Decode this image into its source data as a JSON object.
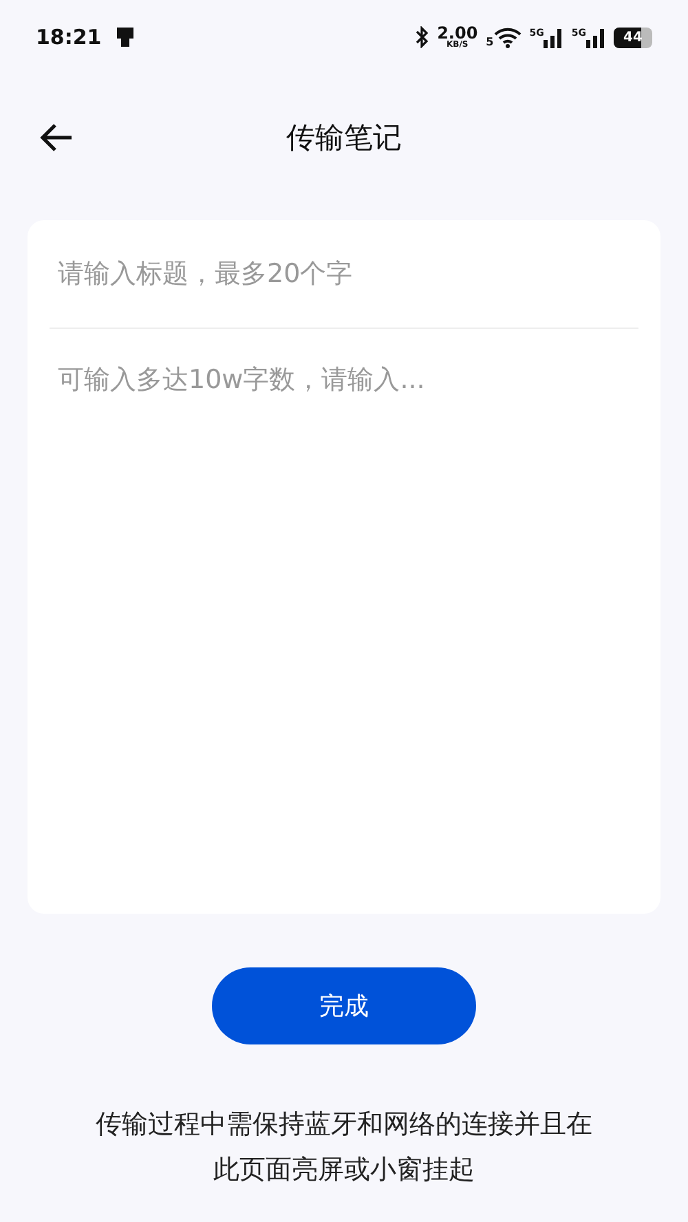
{
  "status_bar": {
    "time": "18:21",
    "speed": "2.00",
    "speed_unit": "KB/S",
    "wifi_band": "5",
    "signal_labels": [
      "5G",
      "5G"
    ],
    "battery": "44"
  },
  "header": {
    "title": "传输笔记"
  },
  "note": {
    "title_placeholder": "请输入标题，最多20个字",
    "body_placeholder": "可输入多达10w字数，请输入..."
  },
  "done_button": "完成",
  "notice": "传输过程中需保持蓝牙和网络的连接并且在此页面亮屏或小窗挂起"
}
